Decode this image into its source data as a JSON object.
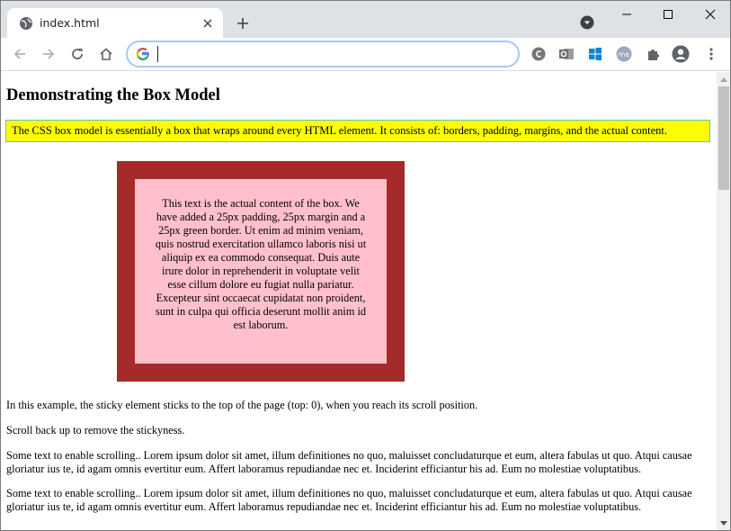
{
  "browser": {
    "tab": {
      "title": "index.html"
    },
    "omnibox": {
      "value": "",
      "placeholder": ""
    },
    "icons": {
      "favicon": "globe-icon",
      "close": "close-icon",
      "new_tab": "plus-icon",
      "profile_dropdown": "dropdown-circle-icon",
      "minimize": "minimize-icon",
      "maximize": "maximize-icon",
      "window_close": "close-icon",
      "back": "back-arrow-icon",
      "forward": "forward-arrow-icon",
      "reload": "reload-icon",
      "home": "home-icon",
      "google": "google-g-icon",
      "extensions": [
        "c-circle-icon",
        "outlook-icon",
        "windows-icon",
        "me-icon",
        "puzzle-icon",
        "account-icon",
        "kebab-menu-icon"
      ]
    }
  },
  "page": {
    "heading": "Demonstrating the Box Model",
    "intro": "The CSS box model is essentially a box that wraps around every HTML element. It consists of: borders, padding, margins, and the actual content.",
    "box_text": "This text is the actual content of the box. We have added a 25px padding, 25px margin and a 25px green border. Ut enim ad minim veniam, quis nostrud exercitation ullamco laboris nisi ut aliquip ex ea commodo consequat. Duis aute irure dolor in reprehenderit in voluptate velit esse cillum dolore eu fugiat nulla pariatur. Excepteur sint occaecat cupidatat non proident, sunt in culpa qui officia deserunt mollit anim id est laborum.",
    "paragraphs": [
      "In this example, the sticky element sticks to the top of the page (top: 0), when you reach its scroll position.",
      "Scroll back up to remove the stickyness.",
      "Some text to enable scrolling.. Lorem ipsum dolor sit amet, illum definitiones no quo, maluisset concludaturque et eum, altera fabulas ut quo. Atqui causae gloriatur ius te, id agam omnis evertitur eum. Affert laboramus repudiandae nec et. Inciderint efficiantur his ad. Eum no molestiae voluptatibus.",
      "Some text to enable scrolling.. Lorem ipsum dolor sit amet, illum definitiones no quo, maluisset concludaturque et eum, altera fabulas ut quo. Atqui causae gloriatur ius te, id agam omnis evertitur eum. Affert laboramus repudiandae nec et. Inciderint efficiantur his ad. Eum no molestiae voluptatibus."
    ],
    "colors": {
      "intro_background": "#ffff00",
      "intro_border": "#5fc2c9",
      "box_border": "#a52a2a",
      "box_background": "#ffc0cb"
    }
  },
  "scrollbar": {
    "position_fraction": 0.0
  }
}
